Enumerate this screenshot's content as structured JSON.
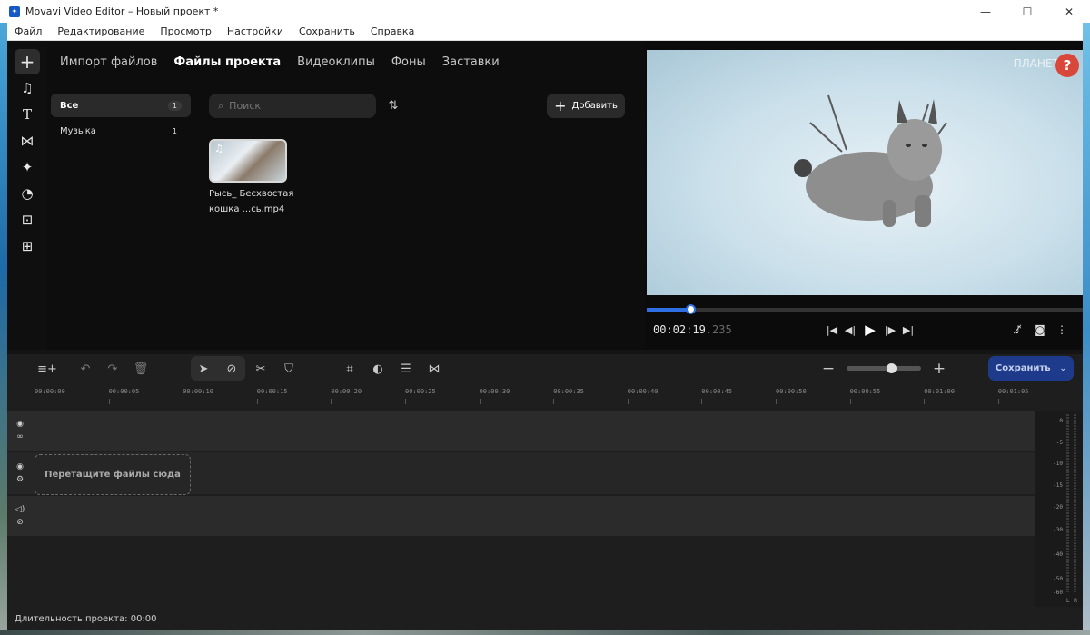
{
  "window": {
    "title": "Movavi Video Editor – Новый проект *"
  },
  "menu": [
    "Файл",
    "Редактирование",
    "Просмотр",
    "Настройки",
    "Сохранить",
    "Справка"
  ],
  "media": {
    "tabs": [
      "Импорт файлов",
      "Файлы проекта",
      "Видеоклипы",
      "Фоны",
      "Заставки"
    ],
    "active_tab": "Файлы проекта",
    "categories": [
      {
        "label": "Все",
        "count": "1"
      },
      {
        "label": "Музыка",
        "count": "1"
      }
    ],
    "search_placeholder": "Поиск",
    "add_label": "Добавить",
    "file_name": "Рысь_ Бесхвостая кошка ...сь.mp4"
  },
  "preview": {
    "watermark": "ПЛАНЕТА",
    "time_main": "00:02:19",
    "time_ms": ".235",
    "progress": 0.1,
    "help_label": "?"
  },
  "timeline": {
    "save_label": "Сохранить",
    "zoom_level": 0.6,
    "ruler": [
      "00:00:00",
      "00:00:05",
      "00:00:10",
      "00:00:15",
      "00:00:20",
      "00:00:25",
      "00:00:30",
      "00:00:35",
      "00:00:40",
      "00:00:45",
      "00:00:50",
      "00:00:55",
      "00:01:00",
      "00:01:05"
    ],
    "drop_label": "Перетащите файлы сюда",
    "meter_labels": [
      "0",
      "-5",
      "-10",
      "-15",
      "-20",
      "-30",
      "-40",
      "-50",
      "-60"
    ],
    "meter_channels": [
      "L",
      "R"
    ]
  },
  "status": {
    "duration": "Длительность проекта: 00:00"
  },
  "colors": {
    "accent": "#2f6fe4",
    "save_button": "#1e3a8a",
    "help": "#d9473a"
  }
}
